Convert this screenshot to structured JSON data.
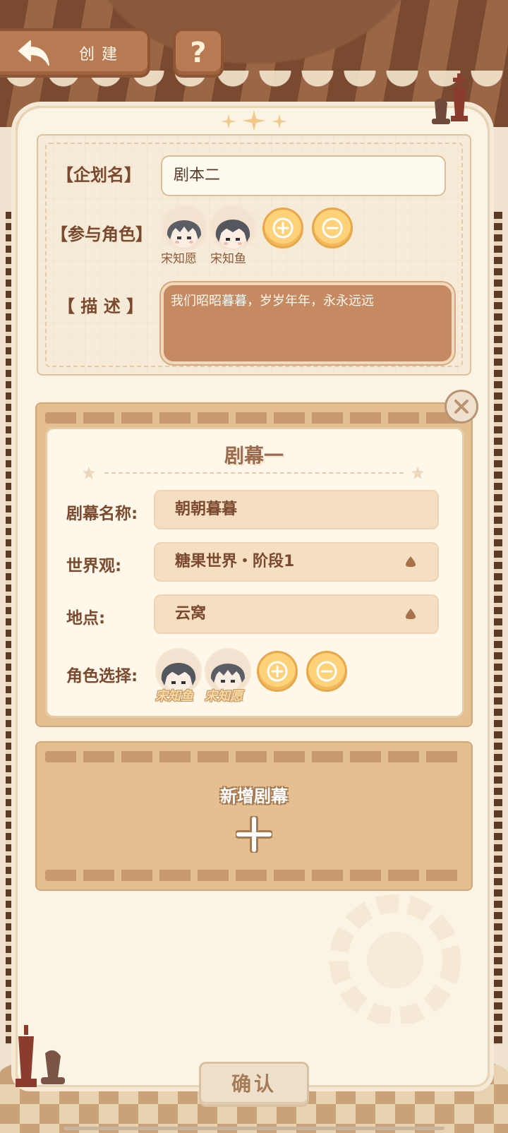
{
  "header": {
    "back_label": "创建",
    "help_label": "?"
  },
  "project": {
    "name_label": "【企划名】",
    "name_value": "剧本二",
    "roles_label": "【参与角色】",
    "roles": [
      {
        "name": "宋知愿"
      },
      {
        "name": "宋知鱼"
      }
    ],
    "desc_label": "【 描  述 】",
    "desc_value": "我们昭昭暮暮，岁岁年年，永永远远"
  },
  "scene": {
    "title": "剧幕一",
    "name_label": "剧幕名称:",
    "name_value": "朝朝暮暮",
    "world_label": "世界观:",
    "world_value": "糖果世界・阶段1",
    "location_label": "地点:",
    "location_value": "云窝",
    "chars_label": "角色选择:",
    "chars": [
      {
        "name": "宋知鱼"
      },
      {
        "name": "宋知愿"
      }
    ]
  },
  "add_scene": {
    "label": "新增剧幕"
  },
  "footer": {
    "confirm_label": "确认"
  },
  "colors": {
    "accent_brown": "#b77a52",
    "text_brown": "#7b4a2e",
    "button_yellow": "#ffd27a",
    "card_bg": "#fbf3e4"
  }
}
